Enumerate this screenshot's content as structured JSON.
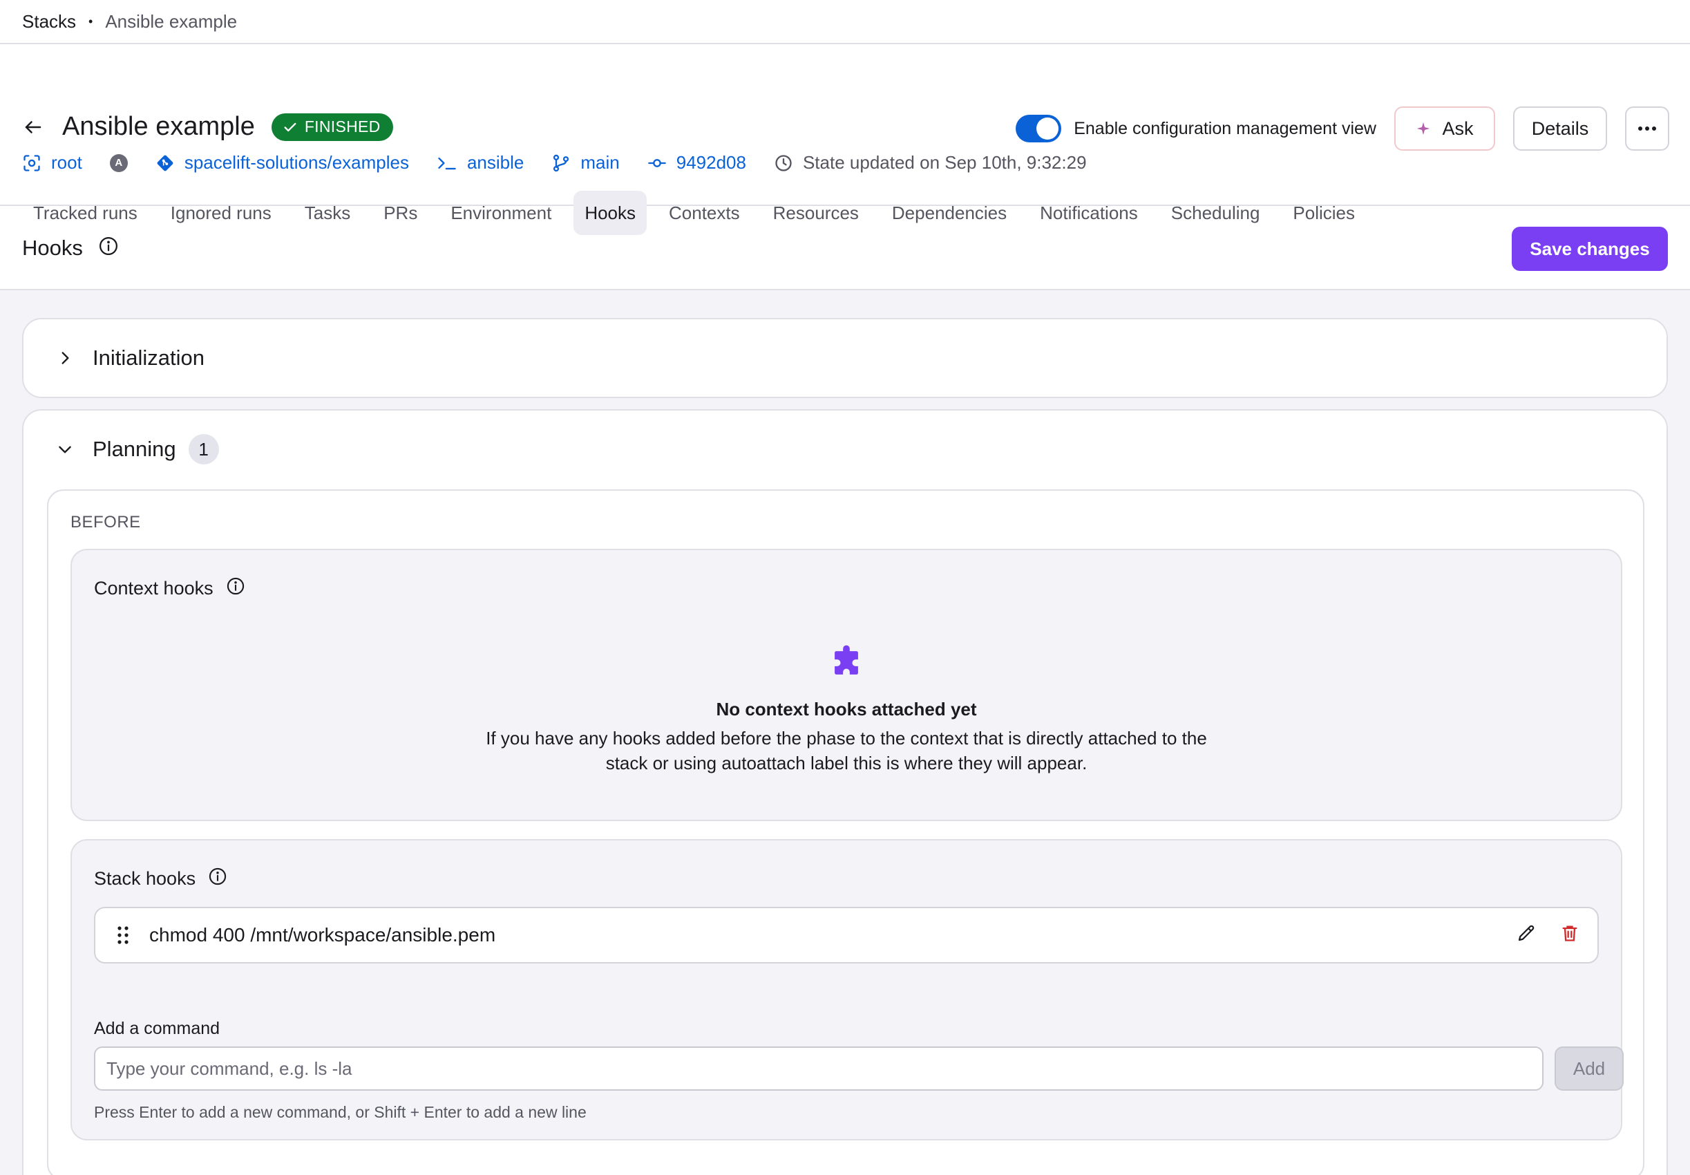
{
  "breadcrumb": {
    "root": "Stacks",
    "separator": "•",
    "current": "Ansible example"
  },
  "header": {
    "title": "Ansible example",
    "status": "FINISHED",
    "config_view_label": "Enable configuration management view",
    "config_view_enabled": true,
    "ask_label": "Ask",
    "details_label": "Details"
  },
  "meta": {
    "space": "root",
    "avatar_letter": "A",
    "repository": "spacelift-solutions/examples",
    "vendor": "ansible",
    "branch": "main",
    "commit": "9492d08",
    "state_updated": "State updated on Sep 10th, 9:32:29"
  },
  "tabs": [
    {
      "label": "Tracked runs",
      "active": false
    },
    {
      "label": "Ignored runs",
      "active": false
    },
    {
      "label": "Tasks",
      "active": false
    },
    {
      "label": "PRs",
      "active": false
    },
    {
      "label": "Environment",
      "active": false
    },
    {
      "label": "Hooks",
      "active": true
    },
    {
      "label": "Contexts",
      "active": false
    },
    {
      "label": "Resources",
      "active": false
    },
    {
      "label": "Dependencies",
      "active": false
    },
    {
      "label": "Notifications",
      "active": false
    },
    {
      "label": "Scheduling",
      "active": false
    },
    {
      "label": "Policies",
      "active": false
    }
  ],
  "section": {
    "title": "Hooks",
    "save_label": "Save changes"
  },
  "phases": {
    "initialization": {
      "title": "Initialization",
      "expanded": false
    },
    "planning": {
      "title": "Planning",
      "count": "1",
      "expanded": true,
      "before_label": "BEFORE",
      "context_hooks": {
        "title": "Context hooks",
        "empty_title": "No context hooks attached yet",
        "empty_desc_line1": "If you have any hooks added before the phase to the context that is directly attached to the",
        "empty_desc_line2": "stack or using autoattach label this is where they will appear."
      },
      "stack_hooks": {
        "title": "Stack hooks",
        "commands": [
          "chmod 400 /mnt/workspace/ansible.pem"
        ],
        "add_label": "Add a command",
        "add_placeholder": "Type your command, e.g. ls -la",
        "add_button": "Add",
        "hint": "Press Enter to add a new command, or Shift + Enter to add a new line"
      }
    }
  },
  "colors": {
    "link": "#0b62d6",
    "success": "#0f7f33",
    "primary": "#7a3ff2",
    "danger": "#d22a2a"
  }
}
